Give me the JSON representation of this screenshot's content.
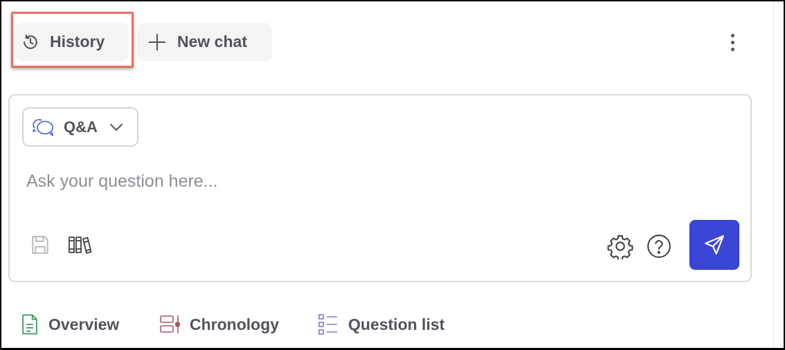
{
  "toolbar": {
    "history_label": "History",
    "new_chat_label": "New chat"
  },
  "composer": {
    "mode_label": "Q&A",
    "input_placeholder": "Ask your question here...",
    "input_value": ""
  },
  "tabs": [
    {
      "label": "Overview",
      "icon": "document-icon",
      "color": "#3f9a6b"
    },
    {
      "label": "Chronology",
      "icon": "timeline-icon",
      "color": "#a35a68"
    },
    {
      "label": "Question list",
      "icon": "checklist-icon",
      "color": "#8b6fd6"
    }
  ],
  "colors": {
    "send_button": "#3a47d5",
    "highlight_border": "#e8705e",
    "mode_icon": "#3a5bd9"
  }
}
